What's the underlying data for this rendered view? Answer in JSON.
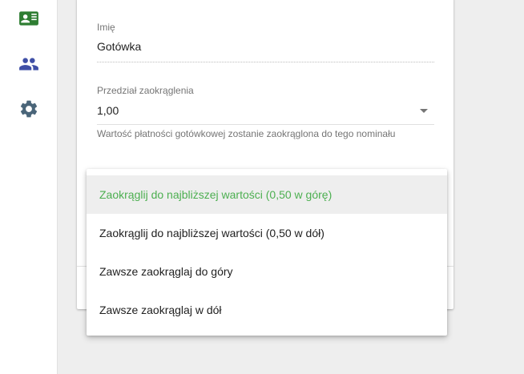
{
  "colors": {
    "primary": "#4caf50",
    "nav_active": "#2e7d32",
    "nav_icon": "#3f4fa6",
    "settings_icon": "#4a6579"
  },
  "sidebar": {
    "items": [
      {
        "icon": "contact-card-icon",
        "active": true
      },
      {
        "icon": "people-icon",
        "active": false
      },
      {
        "icon": "settings-gear-icon",
        "active": false
      }
    ]
  },
  "form": {
    "name_field": {
      "label": "Imię",
      "value": "Gotówka"
    },
    "rounding_interval": {
      "label": "Przedział zaokrąglenia",
      "value": "1,00",
      "helper": "Wartość płatności gotówkowej zostanie zaokrąglona do tego nominału"
    }
  },
  "dropdown": {
    "options": [
      {
        "label": "Zaokrąglij do najbliższej wartości (0,50 w górę)",
        "selected": true
      },
      {
        "label": "Zaokrąglij do najbliższej wartości (0,50 w dół)",
        "selected": false
      },
      {
        "label": "Zawsze zaokrąglaj do góry",
        "selected": false
      },
      {
        "label": "Zawsze zaokrąglaj w dół",
        "selected": false
      }
    ]
  }
}
